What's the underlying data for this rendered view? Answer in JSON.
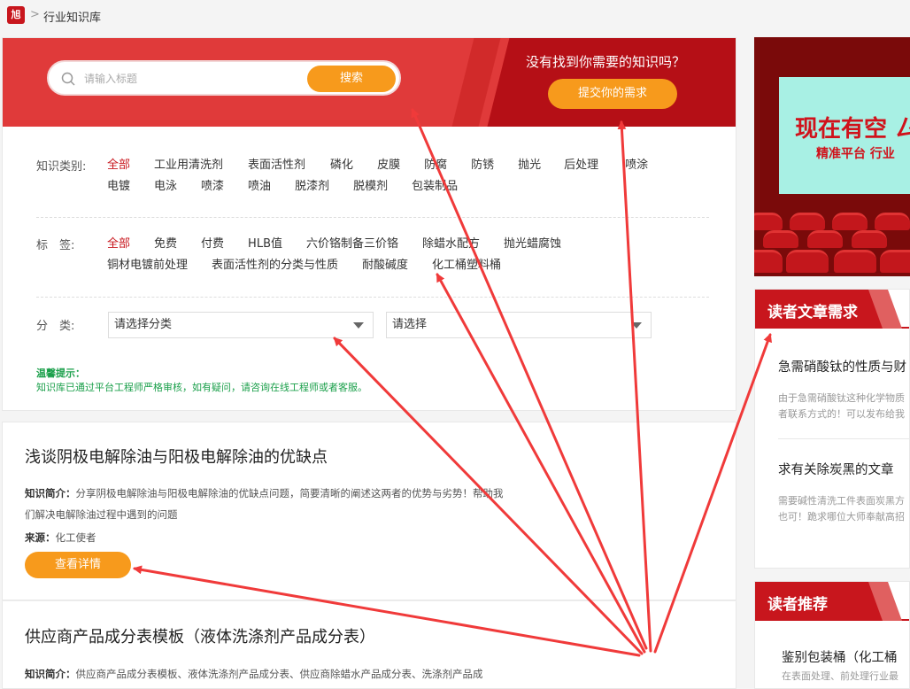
{
  "breadcrumb": {
    "logo": "旭",
    "separator": ">",
    "current": "行业知识库"
  },
  "search": {
    "placeholder": "请输入标题",
    "button": "搜索"
  },
  "need": {
    "title": "没有找到你需要的知识吗？",
    "button": "提交你的需求"
  },
  "filters": {
    "category": {
      "label": "知识类别:",
      "items": [
        "全部",
        "工业用清洗剂",
        "表面活性剂",
        "磷化",
        "皮膜",
        "防腐",
        "防锈",
        "抛光",
        "后处理",
        "喷涂",
        "电镀",
        "电泳",
        "喷漆",
        "喷油",
        "脱漆剂",
        "脱模剂",
        "包装制品"
      ]
    },
    "tags": {
      "label": "标　签:",
      "items": [
        "全部",
        "免费",
        "付费",
        "HLB值",
        "六价铬制备三价铬",
        "除蜡水配方",
        "抛光蜡腐蚀",
        "铜材电镀前处理",
        "表面活性剂的分类与性质",
        "耐酸碱度",
        "化工桶塑料桶"
      ]
    },
    "classify": {
      "label": "分　类:",
      "select1": "请选择分类",
      "select2": "请选择"
    }
  },
  "tip": {
    "title": "温馨提示：",
    "text": "知识库已通过平台工程师严格审核，如有疑问，请咨询在线工程师或者客服。"
  },
  "articles": [
    {
      "title": "浅谈阴极电解除油与阳极电解除油的优缺点",
      "desc_label": "知识简介：",
      "desc": "分享阴极电解除油与阳极电解除油的优缺点问题，简要清晰的阐述这两者的优势与劣势！帮助我们解决电解除油过程中遇到的问题",
      "src_label": "来源：",
      "src": "化工使者",
      "button": "查看详情"
    },
    {
      "title": "供应商产品成分表模板（液体洗涤剂产品成分表）",
      "desc_label": "知识简介：",
      "desc": "供应商产品成分表模板、液体洗涤剂产品成分表、供应商除蜡水产品成分表、洗涤剂产品成"
    }
  ],
  "ad": {
    "line1": "现在有空 ㄙ",
    "line2": "精准平台 行业"
  },
  "reader_needs": {
    "title": "读者文章需求",
    "items": [
      {
        "title": "急需硝酸钛的性质与财",
        "text1": "由于急需硝酸钛这种化学物质",
        "text2": "者联系方式的！可以发布给我"
      },
      {
        "title": "求有关除炭黑的文章",
        "text1": "需要碱性清洗工件表面炭黑方",
        "text2": "也可！跪求哪位大师奉献高招"
      }
    ]
  },
  "reader_recommend": {
    "title": "读者推荐",
    "items": [
      {
        "title": "鉴别包装桶（化工桶",
        "text1": "在表面处理、前处理行业最"
      }
    ]
  },
  "colors": {
    "brand_red": "#c8161d",
    "orange": "#f79a1c",
    "tip_green": "#1a9f4a",
    "arrow_red": "#f03a3a"
  }
}
